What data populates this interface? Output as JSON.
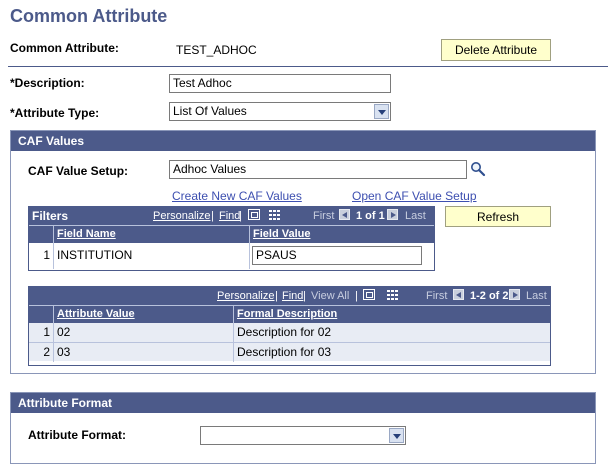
{
  "page": {
    "title": "Common Attribute"
  },
  "common_attribute": {
    "label": "Common Attribute:",
    "value": "TEST_ADHOC"
  },
  "delete_button": {
    "label": "Delete Attribute"
  },
  "description": {
    "label": "*Description:",
    "value": "Test Adhoc"
  },
  "attribute_type": {
    "label": "*Attribute Type:",
    "value": "List Of Values"
  },
  "caf_values": {
    "header": "CAF Values",
    "setup_label": "CAF Value Setup:",
    "setup_value": "Adhoc Values",
    "create_link": "Create New CAF Values",
    "open_link": "Open CAF Value Setup"
  },
  "filters": {
    "title": "Filters",
    "personalize": "Personalize",
    "find": "Find",
    "first": "First",
    "range": "1 of 1",
    "last": "Last",
    "columns": [
      "Field Name",
      "Field Value"
    ],
    "rows": [
      {
        "num": "1",
        "field_name": "INSTITUTION",
        "field_value": "PSAUS"
      }
    ]
  },
  "refresh_button": {
    "label": "Refresh"
  },
  "values_grid": {
    "personalize": "Personalize",
    "find": "Find",
    "view_all": "View All",
    "first": "First",
    "range": "1-2 of 2",
    "last": "Last",
    "columns": [
      "Attribute Value",
      "Formal Description"
    ],
    "rows": [
      {
        "num": "1",
        "value": "02",
        "description": "Description for 02"
      },
      {
        "num": "2",
        "value": "03",
        "description": "Description for 03"
      }
    ]
  },
  "attribute_format": {
    "header": "Attribute Format",
    "label": "Attribute Format:",
    "value": ""
  },
  "colors": {
    "header_bg": "#4c5a8a",
    "button_bg": "#ffffcc",
    "link": "#3d4fb0",
    "title": "#4c5a8a"
  },
  "icons": [
    "lookup-icon",
    "zoom-icon",
    "grid-download-icon",
    "nav-previous-icon",
    "nav-next-icon",
    "dropdown-arrow-icon"
  ]
}
